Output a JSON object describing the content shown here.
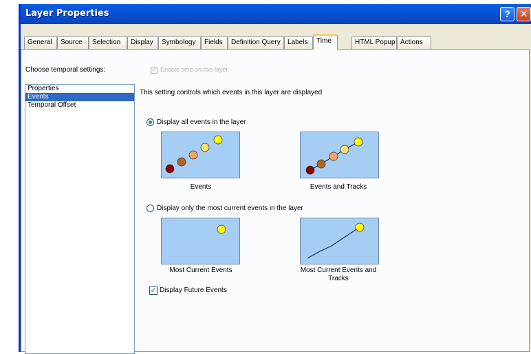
{
  "window": {
    "title": "Layer Properties",
    "help_glyph": "?",
    "close_glyph": "✕"
  },
  "tabs": [
    {
      "label": "General"
    },
    {
      "label": "Source"
    },
    {
      "label": "Selection"
    },
    {
      "label": "Display"
    },
    {
      "label": "Symbology"
    },
    {
      "label": "Fields"
    },
    {
      "label": "Definition Query"
    },
    {
      "label": "Labels"
    },
    {
      "label": "Time",
      "active": true
    },
    {
      "label": "HTML Popup"
    },
    {
      "label": "Actions"
    }
  ],
  "time_tab": {
    "choose_label": "Choose temporal settings:",
    "enable_label": "Enable time on this layer",
    "enable_checked": true,
    "settings_list": [
      "Properties",
      "Events",
      "Temporal Offset"
    ],
    "selected_setting": "Events",
    "description": "This setting controls which events in this layer are displayed",
    "option_all": {
      "label": "Display all events in the layer",
      "selected": true,
      "previews": [
        "Events",
        "Events and Tracks"
      ]
    },
    "option_current": {
      "label": "Display only the most current events in the layer",
      "selected": false,
      "previews": [
        "Most Current Events",
        "Most Current Events and Tracks"
      ]
    },
    "future": {
      "label": "Display Future Events",
      "checked": true,
      "check_glyph": "✓"
    }
  },
  "colors": {
    "title_bar": "#0a5fe0",
    "selected_item": "#316ac5",
    "preview_bg": "#a6cdf4",
    "event_colors": [
      "#8b0000",
      "#b5651d",
      "#f4a460",
      "#ffe070",
      "#ffff00"
    ]
  }
}
